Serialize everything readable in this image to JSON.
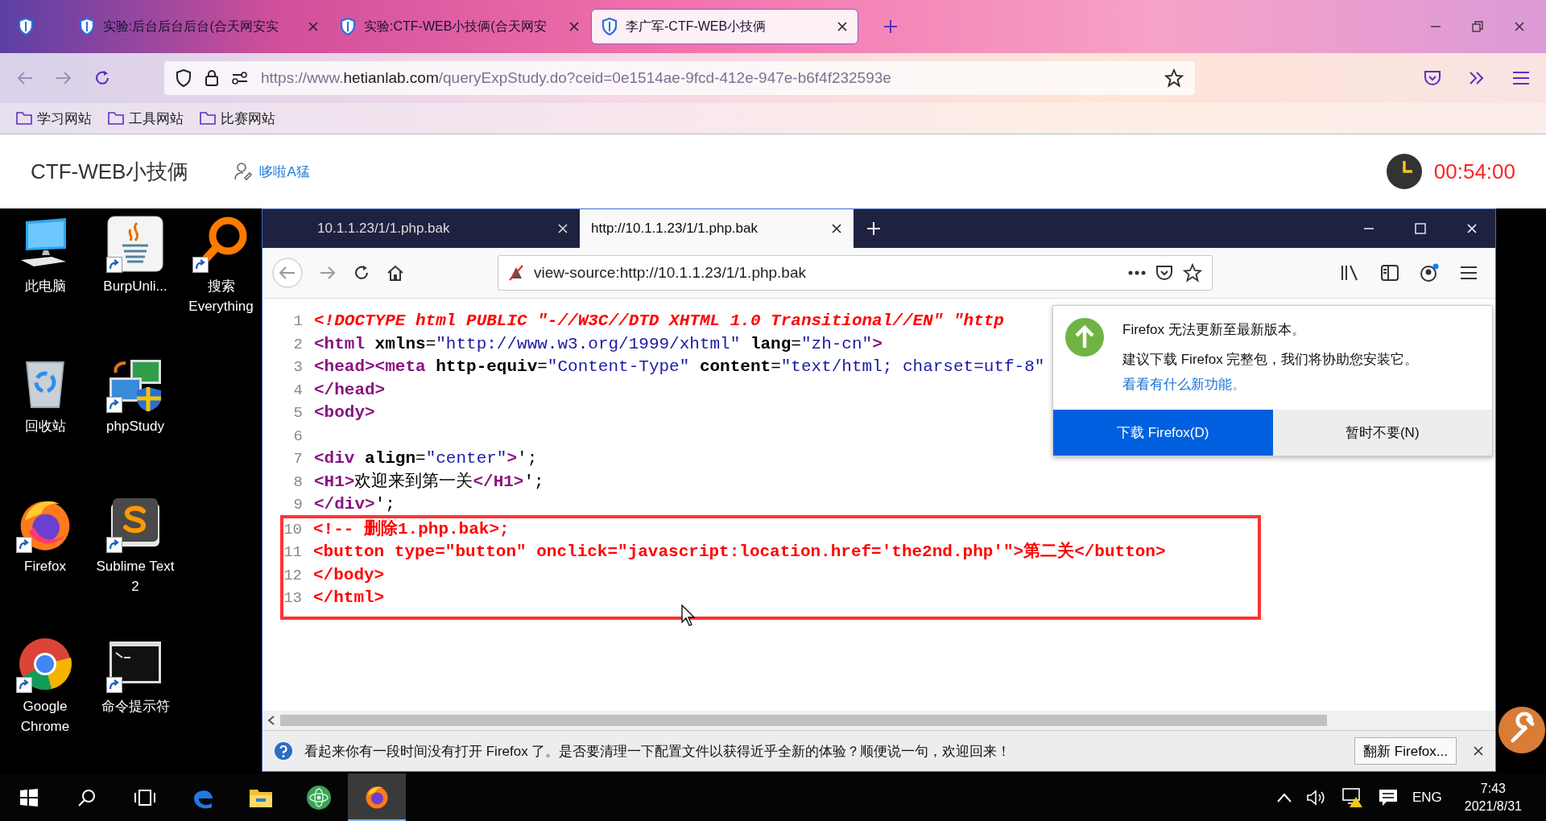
{
  "browser": {
    "tabs": [
      {
        "title": "实验:后台后台后台(合天网安实",
        "selected": false
      },
      {
        "title": "实验:CTF-WEB小技俩(合天网安",
        "selected": false
      },
      {
        "title": "李广军-CTF-WEB小技俩",
        "selected": true
      }
    ],
    "url": "https://www.**hetianlab.com**/queryExpStudy.do?ceid=0e1514ae-9fcd-412e-947e-b6f4f232593e",
    "bookmarks": [
      "学习网站",
      "工具网站",
      "比赛网站"
    ]
  },
  "page_header": {
    "title": "CTF-WEB小技俩",
    "user": "哆啦A猛",
    "timer": "00:54:00"
  },
  "desktop": {
    "icons": [
      {
        "label": "此电脑",
        "kind": "computer",
        "shortcut": false
      },
      {
        "label": "回收站",
        "kind": "recycle",
        "shortcut": false
      },
      {
        "label": "Firefox",
        "kind": "firefox",
        "shortcut": true
      },
      {
        "label": "Google Chrome",
        "kind": "chrome",
        "shortcut": true
      },
      {
        "label": "BurpUnli...",
        "kind": "java",
        "shortcut": true
      },
      {
        "label": "phpStudy",
        "kind": "phpstudy",
        "shortcut": true
      },
      {
        "label": "Sublime Text 2",
        "kind": "sublime",
        "shortcut": true
      },
      {
        "label": "命令提示符",
        "kind": "cmd",
        "shortcut": true
      },
      {
        "label": "搜索 Everything",
        "kind": "everything",
        "shortcut": true
      }
    ]
  },
  "firefox": {
    "tabs": [
      {
        "title": "10.1.1.23/1/1.php.bak",
        "selected": false
      },
      {
        "title": "http://10.1.1.23/1/1.php.bak",
        "selected": true
      }
    ],
    "url": "view-source:http://10.1.1.23/1/1.php.bak",
    "source": {
      "lines": [
        {
          "number": "1",
          "segments": [
            {
              "kind": "doctype",
              "text": "<!DOCTYPE html PUBLIC \"-//W3C//DTD XHTML 1.0 Transitional//EN\" \"http"
            }
          ]
        },
        {
          "number": "2",
          "segments": [
            {
              "kind": "tag",
              "text": "<html"
            },
            {
              "kind": "attr",
              "text": " xmlns"
            },
            {
              "kind": "text",
              "text": "="
            },
            {
              "kind": "value",
              "text": "\"http://www.w3.org/1999/xhtml\""
            },
            {
              "kind": "attr",
              "text": " lang"
            },
            {
              "kind": "text",
              "text": "="
            },
            {
              "kind": "value",
              "text": "\"zh-cn\""
            },
            {
              "kind": "tag",
              "text": ">"
            }
          ]
        },
        {
          "number": "3",
          "segments": [
            {
              "kind": "tag",
              "text": "<head><meta"
            },
            {
              "kind": "attr",
              "text": " http-equiv"
            },
            {
              "kind": "text",
              "text": "="
            },
            {
              "kind": "value",
              "text": "\"Content-Type\""
            },
            {
              "kind": "attr",
              "text": " content"
            },
            {
              "kind": "text",
              "text": "="
            },
            {
              "kind": "value",
              "text": "\"text/html; charset=utf-8\""
            }
          ]
        },
        {
          "number": "4",
          "segments": [
            {
              "kind": "tag",
              "text": "</head>"
            }
          ]
        },
        {
          "number": "5",
          "segments": [
            {
              "kind": "tag",
              "text": "<body>"
            }
          ]
        },
        {
          "number": "6"
        },
        {
          "number": "7",
          "segments": [
            {
              "kind": "tag",
              "text": "<div"
            },
            {
              "kind": "attr",
              "text": " align"
            },
            {
              "kind": "text",
              "text": "="
            },
            {
              "kind": "value",
              "text": "\"center\""
            },
            {
              "kind": "tag",
              "text": ">"
            },
            {
              "kind": "text",
              "text": "';"
            }
          ]
        },
        {
          "number": "8",
          "segments": [
            {
              "kind": "tag",
              "text": "<H1>"
            },
            {
              "kind": "text",
              "text": "欢迎来到第一关"
            },
            {
              "kind": "tag",
              "text": "</H1>"
            },
            {
              "kind": "text",
              "text": "';"
            }
          ]
        },
        {
          "number": "9",
          "segments": [
            {
              "kind": "tag",
              "text": "</div>"
            },
            {
              "kind": "text",
              "text": "';"
            }
          ]
        }
      ],
      "boxed_lines": [
        {
          "number": "10",
          "segments": [
            {
              "kind": "error",
              "text": "<!-- 删除1.php.bak>;"
            }
          ]
        },
        {
          "number": "11",
          "segments": [
            {
              "kind": "error",
              "text": "<button type=\"button\" onclick=\"javascript:location.href='the2nd.php'\">第二关</button>"
            }
          ]
        },
        {
          "number": "12",
          "segments": [
            {
              "kind": "error",
              "text": "</body>"
            }
          ]
        },
        {
          "number": "13",
          "segments": [
            {
              "kind": "error",
              "text": "</html>"
            }
          ]
        }
      ]
    },
    "update_popup": {
      "title": "Firefox 无法更新至最新版本。",
      "message": "建议下载 Firefox 完整包，我们将协助您安装它。",
      "link": "看看有什么新功能。",
      "primary_button": "下载 Firefox(D)",
      "secondary_button": "暂时不要(N)"
    },
    "notification": {
      "message": "看起来你有一段时间没有打开 Firefox 了。是否要清理一下配置文件以获得近乎全新的体验？顺便说一句，欢迎回来！",
      "button": "翻新 Firefox..."
    }
  },
  "taskbar": {
    "apps": [
      {
        "kind": "edge",
        "selected": false
      },
      {
        "kind": "explorer",
        "selected": false
      },
      {
        "kind": "atom",
        "selected": false
      },
      {
        "kind": "firefox",
        "selected": true
      }
    ],
    "language": "ENG",
    "time": "7:43",
    "date": "2021/8/31"
  }
}
